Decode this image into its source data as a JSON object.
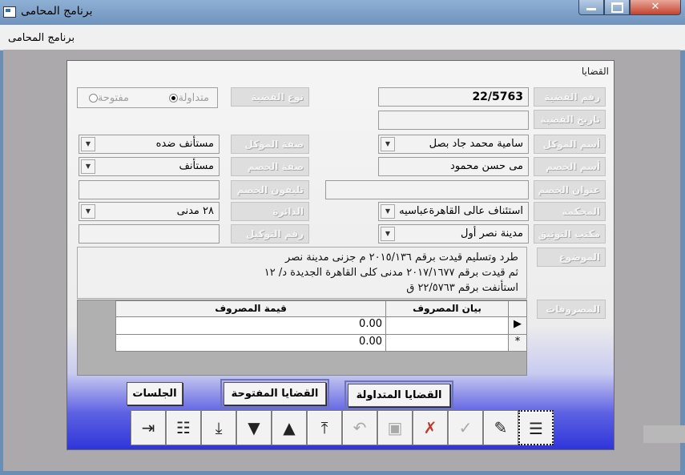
{
  "window": {
    "title": "برنامج المحامى"
  },
  "menu": {
    "items": [
      "برنامج المحامى"
    ]
  },
  "form": {
    "title": "القضايا",
    "labels": {
      "case_number": "رقم القضية",
      "case_date": "تاريخ القضية",
      "client_name": "أسم الموكل",
      "opponent_name": "أسم الخصم",
      "opponent_address": "عنوان الخصم",
      "court": "المحكمة",
      "notary_office": "مكتب التوثيق",
      "subject": "الموضوع",
      "expenses": "المصروفات",
      "case_type": "نوع القضية",
      "client_capacity": "صفة الموكل",
      "opponent_capacity": "صفة الخصم",
      "opponent_phone": "تليفون الخصم",
      "circuit": "الدائرة",
      "power_of_attorney_number": "رقم التوكيل"
    },
    "values": {
      "case_number": "22/5763",
      "case_date": "",
      "client_name": "سامية محمد جاد بصل",
      "opponent_name": "مى حسن محمود",
      "opponent_address": "",
      "court": "استئناف عالى القاهرةعباسيه",
      "notary_office": "مدينة نصر أول",
      "client_capacity": "مستأنف ضده",
      "opponent_capacity": "مستأنف",
      "opponent_phone": "",
      "circuit": "٢٨ مدنى",
      "power_of_attorney_number": ""
    },
    "case_type_options": [
      {
        "label": "متداولة",
        "selected": true
      },
      {
        "label": "مفتوحة",
        "selected": false
      }
    ],
    "subject_lines": [
      "طرد وتسليم قيدت برقم ٢٠١٥/١٣٦ م جزنى مدينة نصر",
      "ثم قيدت برقم ٢٠١٧/١٦٧٧ مدنى كلى القاهرة الجديدة د/ ١٢",
      "استأنفت برقم ٢٢/٥٧٦٣ ق"
    ],
    "expenses_grid": {
      "columns": [
        "بيان المصروف",
        "قيمة المصروف"
      ],
      "rows": [
        {
          "indicator": "▶",
          "description": "",
          "amount": "0.00"
        },
        {
          "indicator": "*",
          "description": "",
          "amount": "0.00"
        }
      ]
    }
  },
  "buttons": {
    "active_cases": "القضايا المتداولة",
    "open_cases": "القضايا المفتوحة",
    "sessions": "الجلسات"
  },
  "toolbar_icons": [
    "exit-icon",
    "list-icon",
    "last-record-icon",
    "next-record-icon",
    "previous-record-icon",
    "first-record-icon",
    "undo-icon",
    "save-icon",
    "delete-icon",
    "confirm-icon",
    "edit-icon",
    "new-record-icon"
  ]
}
